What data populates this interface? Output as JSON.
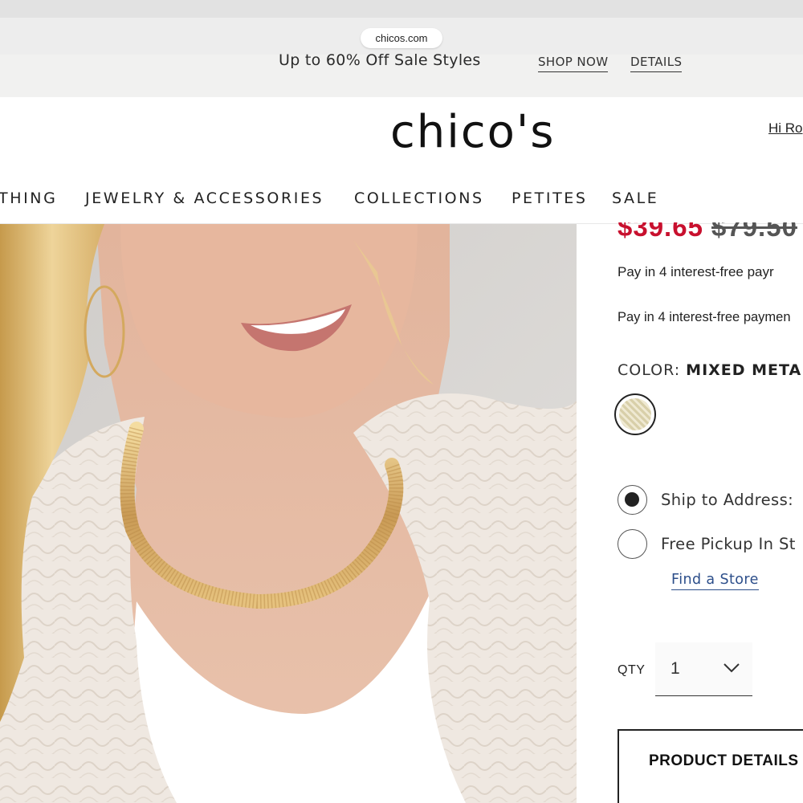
{
  "browser": {
    "url": "chicos.com"
  },
  "promo_banner": {
    "text": "Up to 60% Off Sale Styles",
    "shop_now_label": "SHOP NOW",
    "details_label": "DETAILS"
  },
  "header": {
    "logo": "chico's",
    "greeting": "Hi Ro"
  },
  "nav": {
    "items": [
      {
        "label": "THING"
      },
      {
        "label": "JEWELRY & ACCESSORIES"
      },
      {
        "label": "COLLECTIONS"
      },
      {
        "label": "PETITES"
      },
      {
        "label": "SALE"
      }
    ]
  },
  "product": {
    "sale_price": "$39.65",
    "original_price": "$79.50",
    "pay_line_1": "Pay in 4 interest-free payr",
    "pay_line_2": "Pay in 4 interest-free paymen",
    "color_label": "COLOR:",
    "color_value": "MIXED META",
    "swatch_icon": "mixed-metal-swatch",
    "shipping": {
      "ship_to_address": "Ship to Address:",
      "free_pickup": "Free Pickup In St",
      "find_store": "Find a Store",
      "selected": "ship_to_address"
    },
    "qty": {
      "label": "QTY",
      "value": "1"
    },
    "details_button": "PRODUCT DETAILS"
  },
  "colors": {
    "sale_red": "#c8102e",
    "link_blue": "#2c4e8a",
    "promo_bg": "#f1f1f0"
  }
}
